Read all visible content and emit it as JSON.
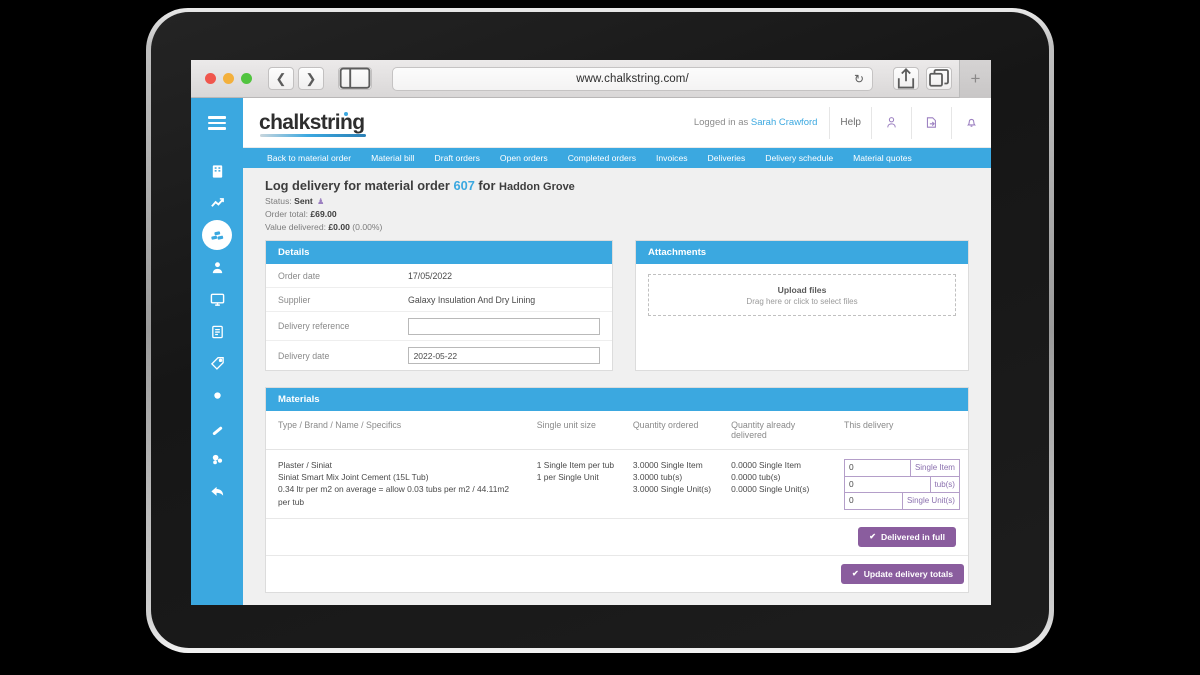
{
  "browser": {
    "url": "www.chalkstring.com/",
    "back_icon": "chevron-left-icon",
    "forward_icon": "chevron-right-icon",
    "sidebar_icon": "sidebar-toggle-icon",
    "reload_icon": "reload-icon",
    "share_icon": "share-icon",
    "tabs_icon": "tabs-icon",
    "new_tab_label": "+"
  },
  "sidebar": {
    "menu_icon": "hamburger-icon",
    "items": [
      {
        "name": "sidebar-item-projects",
        "icon": "building-icon",
        "active": false
      },
      {
        "name": "sidebar-item-reports",
        "icon": "chart-line-icon",
        "active": false
      },
      {
        "name": "sidebar-item-materials",
        "icon": "bricks-icon",
        "active": true
      },
      {
        "name": "sidebar-item-labour",
        "icon": "person-icon",
        "active": false
      },
      {
        "name": "sidebar-item-plant",
        "icon": "monitor-icon",
        "active": false
      },
      {
        "name": "sidebar-item-documents",
        "icon": "clipboard-icon",
        "active": false
      },
      {
        "name": "sidebar-item-pricing",
        "icon": "tag-icon",
        "active": false
      },
      {
        "name": "sidebar-item-dot",
        "icon": "circle-icon",
        "active": false
      },
      {
        "name": "sidebar-item-tools",
        "icon": "pencil-icon",
        "active": false
      },
      {
        "name": "sidebar-item-settings",
        "icon": "gear-group-icon",
        "active": false
      },
      {
        "name": "sidebar-item-back",
        "icon": "back-arrow-icon",
        "active": false
      }
    ]
  },
  "topbar": {
    "logo": "chalkstring",
    "logged_in_prefix": "Logged in as",
    "user_name": "Sarah Crawford",
    "help_label": "Help",
    "user_icon": "user-icon",
    "export_icon": "export-document-icon",
    "bell_icon": "bell-icon"
  },
  "navbar": {
    "items": [
      "Back to material order",
      "Material bill",
      "Draft orders",
      "Open orders",
      "Completed orders",
      "Invoices",
      "Deliveries",
      "Delivery schedule",
      "Material quotes"
    ]
  },
  "page": {
    "title_prefix": "Log delivery for material order",
    "order_number": "607",
    "title_for": "for",
    "customer": "Haddon Grove",
    "status_label": "Status:",
    "status_value": "Sent",
    "status_icon": "person-badge-icon",
    "order_total_label": "Order total:",
    "order_total_value": "£69.00",
    "value_delivered_label": "Value delivered:",
    "value_delivered_value": "£0.00",
    "value_delivered_pct": "(0.00%)"
  },
  "details": {
    "heading": "Details",
    "order_date_label": "Order date",
    "order_date_value": "17/05/2022",
    "supplier_label": "Supplier",
    "supplier_value": "Galaxy Insulation And Dry Lining",
    "delivery_ref_label": "Delivery reference",
    "delivery_ref_value": "",
    "delivery_ref_placeholder": "",
    "delivery_date_label": "Delivery date",
    "delivery_date_value": "2022-05-22"
  },
  "attachments": {
    "heading": "Attachments",
    "upload_title": "Upload files",
    "upload_sub": "Drag here or click to select files"
  },
  "materials": {
    "heading": "Materials",
    "columns": [
      "Type / Brand / Name / Specifics",
      "Single unit size",
      "Quantity ordered",
      "Quantity already delivered",
      "This delivery"
    ],
    "rows": [
      {
        "type_brand": "Plaster / Siniat",
        "name": "Siniat Smart Mix Joint Cement (15L Tub)",
        "specifics": "0.34 ltr per m2 on average = allow 0.03 tubs per m2 / 44.11m2 per tub",
        "unit_size_lines": [
          "1 Single Item per tub",
          "1 per Single Unit"
        ],
        "ordered_lines": [
          "3.0000 Single Item",
          "3.0000 tub(s)",
          "3.0000 Single Unit(s)"
        ],
        "delivered_lines": [
          "0.0000 Single Item",
          "0.0000 tub(s)",
          "0.0000 Single Unit(s)"
        ],
        "this_delivery": [
          {
            "value": "0",
            "unit": "Single Item"
          },
          {
            "value": "0",
            "unit": "tub(s)"
          },
          {
            "value": "0",
            "unit": "Single Unit(s)"
          }
        ]
      }
    ],
    "delivered_in_full_label": "Delivered in full",
    "update_totals_label": "Update delivery totals",
    "check_icon": "check-icon"
  },
  "colors": {
    "brand_blue": "#3ba8e0",
    "purple": "#8a5d9e",
    "input_purple": "#b49ec9",
    "page_bg": "#f0f0f0"
  }
}
